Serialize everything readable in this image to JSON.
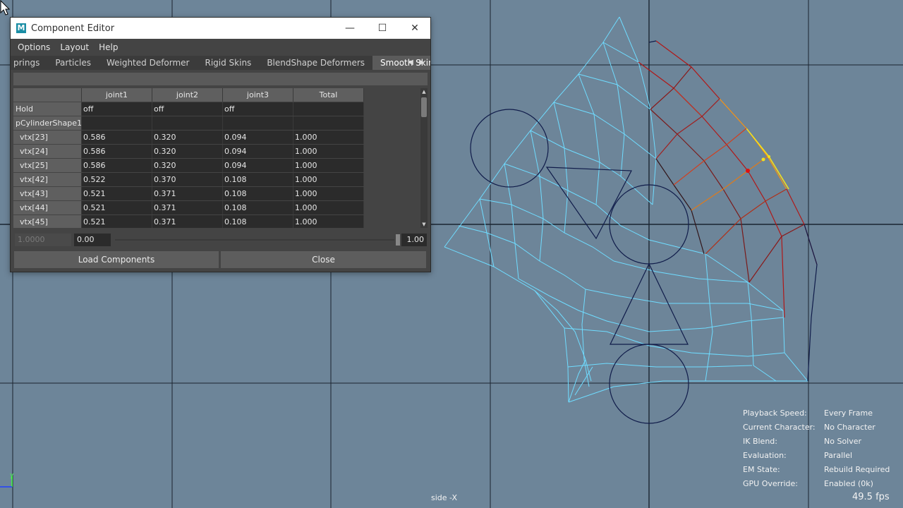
{
  "window": {
    "title": "Component Editor",
    "app_icon_letter": "M",
    "controls": {
      "minimize": "—",
      "maximize": "☐",
      "close": "✕"
    }
  },
  "menu": [
    "Options",
    "Layout",
    "Help"
  ],
  "tabs": {
    "items": [
      "prings",
      "Particles",
      "Weighted Deformer",
      "Rigid Skins",
      "BlendShape Deformers",
      "Smooth Skins"
    ],
    "active": "Smooth Skins",
    "arrow_left": "◀",
    "arrow_right": "▶"
  },
  "table": {
    "columns": [
      "",
      "joint1",
      "joint2",
      "joint3",
      "Total"
    ],
    "hold_row": {
      "label": "Hold",
      "values": [
        "off",
        "off",
        "off",
        ""
      ]
    },
    "shape_row": {
      "label": "pCylinderShape1"
    },
    "rows": [
      {
        "label": "vtx[23]",
        "values": [
          "0.586",
          "0.320",
          "0.094",
          "1.000"
        ]
      },
      {
        "label": "vtx[24]",
        "values": [
          "0.586",
          "0.320",
          "0.094",
          "1.000"
        ]
      },
      {
        "label": "vtx[25]",
        "values": [
          "0.586",
          "0.320",
          "0.094",
          "1.000"
        ]
      },
      {
        "label": "vtx[42]",
        "values": [
          "0.522",
          "0.370",
          "0.108",
          "1.000"
        ]
      },
      {
        "label": "vtx[43]",
        "values": [
          "0.521",
          "0.371",
          "0.108",
          "1.000"
        ]
      },
      {
        "label": "vtx[44]",
        "values": [
          "0.521",
          "0.371",
          "0.108",
          "1.000"
        ]
      },
      {
        "label": "vtx[45]",
        "values": [
          "0.521",
          "0.371",
          "0.108",
          "1.000"
        ]
      }
    ]
  },
  "bottom": {
    "dim_field": "1.0000",
    "value_field": "0.00",
    "slider_max": "1.00"
  },
  "buttons": {
    "load": "Load Components",
    "close": "Close"
  },
  "viewport": {
    "camera_label": "side -X",
    "fps": "49.5 fps",
    "hud": [
      {
        "key": "Playback Speed:",
        "value": "Every Frame"
      },
      {
        "key": "Current Character:",
        "value": "No Character"
      },
      {
        "key": "IK Blend:",
        "value": "No Solver"
      },
      {
        "key": "Evaluation:",
        "value": "Parallel"
      },
      {
        "key": "EM State:",
        "value": "Rebuild Required"
      },
      {
        "key": "GPU Override:",
        "value": "Enabled (0k)"
      }
    ],
    "axis_label": "y",
    "colors": {
      "background": "#6d8599",
      "mesh_cyan": "#6fdcff",
      "mesh_red": "#b01818",
      "mesh_orange": "#e07a1a",
      "mesh_yellow": "#f0e020",
      "joint_navy": "#101c4a"
    }
  }
}
